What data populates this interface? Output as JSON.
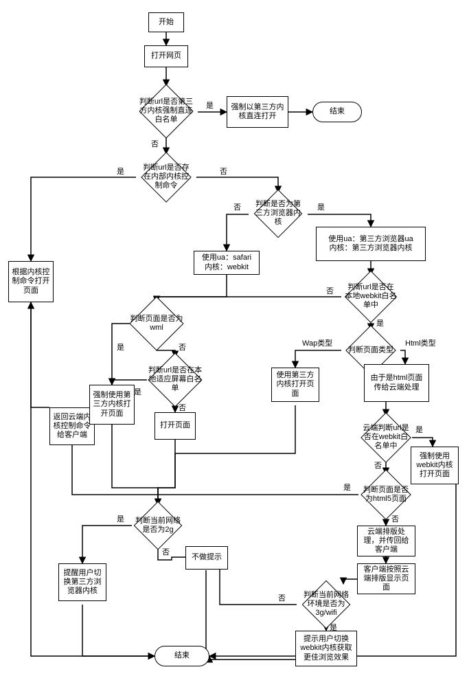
{
  "labels": {
    "yes": "是",
    "no": "否",
    "wapType": "Wap类型",
    "htmlType": "Html类型"
  },
  "nodes": {
    "start": "开始",
    "openPage": "打开网页",
    "d1": "判断url是否第三方内核强制直连白名单",
    "forceThirdDirect": "强制以第三方内核直连打开",
    "end1": "结束",
    "d2": "判断url是否存在内部内核控制命令",
    "d3": "判断是否为第三方浏览器内核",
    "useSafari": "使用ua：safari\n内核：webkit",
    "useThirdUA": "使用ua：第三方浏览器ua\n内核：第三方浏览器内核",
    "d4": "判断url是否在本地webkit白名单中",
    "d5": "判断页面类型",
    "useThirdOpen": "使用第三方内核打开页面",
    "cloudProcess": "由于是html页面传给云端处理",
    "d6": "云端判断url是否在webkit白名单中",
    "forceWebkit": "强制使用webkit内核打开页面",
    "d7": "判断页面是否为html5页面",
    "cloudLayout": "云端排版处理，并传回给客户端",
    "clientDisplay": "客户端按照云端排版显示页面",
    "d8": "判断当前网络环境是否为3g/wifi",
    "promptWebkit": "提示用户切换webkit内核获取更佳浏览效果",
    "openByCmd": "根据内核控制命令打开页面",
    "returnCmd": "返回云端内核控制命令给客户端",
    "dWml": "判断页面是否为wml",
    "dLocalFit": "判断url是否在本地适应屏幕白名单",
    "forceThirdOpen": "强制使用第三方内核打开页面",
    "openPage2": "打开页面",
    "d2g": "判断当前网络是否为2g",
    "remindThird": "提醒用户切换第三方浏览器内核",
    "noPrompt": "不做提示",
    "end2": "结束"
  }
}
